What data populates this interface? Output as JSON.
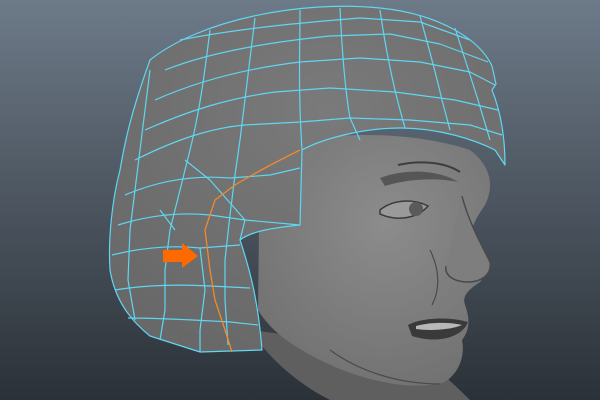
{
  "viewport": {
    "background_top": "#6d7a88",
    "background_bottom": "#2b3138"
  },
  "model": {
    "head_shade": "#6f6f6f",
    "head_highlight": "#8c8c8c",
    "hair_shade": "#676767",
    "wireframe_color": "#5fd6f2",
    "selected_edge_color": "#f08a2c"
  },
  "annotation": {
    "arrow_color": "#ff6a00",
    "arrow_icon": "right-arrow"
  }
}
